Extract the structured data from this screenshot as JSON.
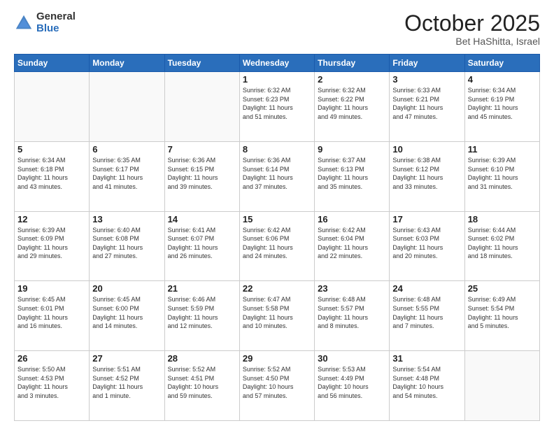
{
  "header": {
    "logo_general": "General",
    "logo_blue": "Blue",
    "title": "October 2025",
    "location": "Bet HaShitta, Israel"
  },
  "days_of_week": [
    "Sunday",
    "Monday",
    "Tuesday",
    "Wednesday",
    "Thursday",
    "Friday",
    "Saturday"
  ],
  "weeks": [
    [
      {
        "day": "",
        "info": ""
      },
      {
        "day": "",
        "info": ""
      },
      {
        "day": "",
        "info": ""
      },
      {
        "day": "1",
        "info": "Sunrise: 6:32 AM\nSunset: 6:23 PM\nDaylight: 11 hours\nand 51 minutes."
      },
      {
        "day": "2",
        "info": "Sunrise: 6:32 AM\nSunset: 6:22 PM\nDaylight: 11 hours\nand 49 minutes."
      },
      {
        "day": "3",
        "info": "Sunrise: 6:33 AM\nSunset: 6:21 PM\nDaylight: 11 hours\nand 47 minutes."
      },
      {
        "day": "4",
        "info": "Sunrise: 6:34 AM\nSunset: 6:19 PM\nDaylight: 11 hours\nand 45 minutes."
      }
    ],
    [
      {
        "day": "5",
        "info": "Sunrise: 6:34 AM\nSunset: 6:18 PM\nDaylight: 11 hours\nand 43 minutes."
      },
      {
        "day": "6",
        "info": "Sunrise: 6:35 AM\nSunset: 6:17 PM\nDaylight: 11 hours\nand 41 minutes."
      },
      {
        "day": "7",
        "info": "Sunrise: 6:36 AM\nSunset: 6:15 PM\nDaylight: 11 hours\nand 39 minutes."
      },
      {
        "day": "8",
        "info": "Sunrise: 6:36 AM\nSunset: 6:14 PM\nDaylight: 11 hours\nand 37 minutes."
      },
      {
        "day": "9",
        "info": "Sunrise: 6:37 AM\nSunset: 6:13 PM\nDaylight: 11 hours\nand 35 minutes."
      },
      {
        "day": "10",
        "info": "Sunrise: 6:38 AM\nSunset: 6:12 PM\nDaylight: 11 hours\nand 33 minutes."
      },
      {
        "day": "11",
        "info": "Sunrise: 6:39 AM\nSunset: 6:10 PM\nDaylight: 11 hours\nand 31 minutes."
      }
    ],
    [
      {
        "day": "12",
        "info": "Sunrise: 6:39 AM\nSunset: 6:09 PM\nDaylight: 11 hours\nand 29 minutes."
      },
      {
        "day": "13",
        "info": "Sunrise: 6:40 AM\nSunset: 6:08 PM\nDaylight: 11 hours\nand 27 minutes."
      },
      {
        "day": "14",
        "info": "Sunrise: 6:41 AM\nSunset: 6:07 PM\nDaylight: 11 hours\nand 26 minutes."
      },
      {
        "day": "15",
        "info": "Sunrise: 6:42 AM\nSunset: 6:06 PM\nDaylight: 11 hours\nand 24 minutes."
      },
      {
        "day": "16",
        "info": "Sunrise: 6:42 AM\nSunset: 6:04 PM\nDaylight: 11 hours\nand 22 minutes."
      },
      {
        "day": "17",
        "info": "Sunrise: 6:43 AM\nSunset: 6:03 PM\nDaylight: 11 hours\nand 20 minutes."
      },
      {
        "day": "18",
        "info": "Sunrise: 6:44 AM\nSunset: 6:02 PM\nDaylight: 11 hours\nand 18 minutes."
      }
    ],
    [
      {
        "day": "19",
        "info": "Sunrise: 6:45 AM\nSunset: 6:01 PM\nDaylight: 11 hours\nand 16 minutes."
      },
      {
        "day": "20",
        "info": "Sunrise: 6:45 AM\nSunset: 6:00 PM\nDaylight: 11 hours\nand 14 minutes."
      },
      {
        "day": "21",
        "info": "Sunrise: 6:46 AM\nSunset: 5:59 PM\nDaylight: 11 hours\nand 12 minutes."
      },
      {
        "day": "22",
        "info": "Sunrise: 6:47 AM\nSunset: 5:58 PM\nDaylight: 11 hours\nand 10 minutes."
      },
      {
        "day": "23",
        "info": "Sunrise: 6:48 AM\nSunset: 5:57 PM\nDaylight: 11 hours\nand 8 minutes."
      },
      {
        "day": "24",
        "info": "Sunrise: 6:48 AM\nSunset: 5:55 PM\nDaylight: 11 hours\nand 7 minutes."
      },
      {
        "day": "25",
        "info": "Sunrise: 6:49 AM\nSunset: 5:54 PM\nDaylight: 11 hours\nand 5 minutes."
      }
    ],
    [
      {
        "day": "26",
        "info": "Sunrise: 5:50 AM\nSunset: 4:53 PM\nDaylight: 11 hours\nand 3 minutes."
      },
      {
        "day": "27",
        "info": "Sunrise: 5:51 AM\nSunset: 4:52 PM\nDaylight: 11 hours\nand 1 minute."
      },
      {
        "day": "28",
        "info": "Sunrise: 5:52 AM\nSunset: 4:51 PM\nDaylight: 10 hours\nand 59 minutes."
      },
      {
        "day": "29",
        "info": "Sunrise: 5:52 AM\nSunset: 4:50 PM\nDaylight: 10 hours\nand 57 minutes."
      },
      {
        "day": "30",
        "info": "Sunrise: 5:53 AM\nSunset: 4:49 PM\nDaylight: 10 hours\nand 56 minutes."
      },
      {
        "day": "31",
        "info": "Sunrise: 5:54 AM\nSunset: 4:48 PM\nDaylight: 10 hours\nand 54 minutes."
      },
      {
        "day": "",
        "info": ""
      }
    ]
  ]
}
